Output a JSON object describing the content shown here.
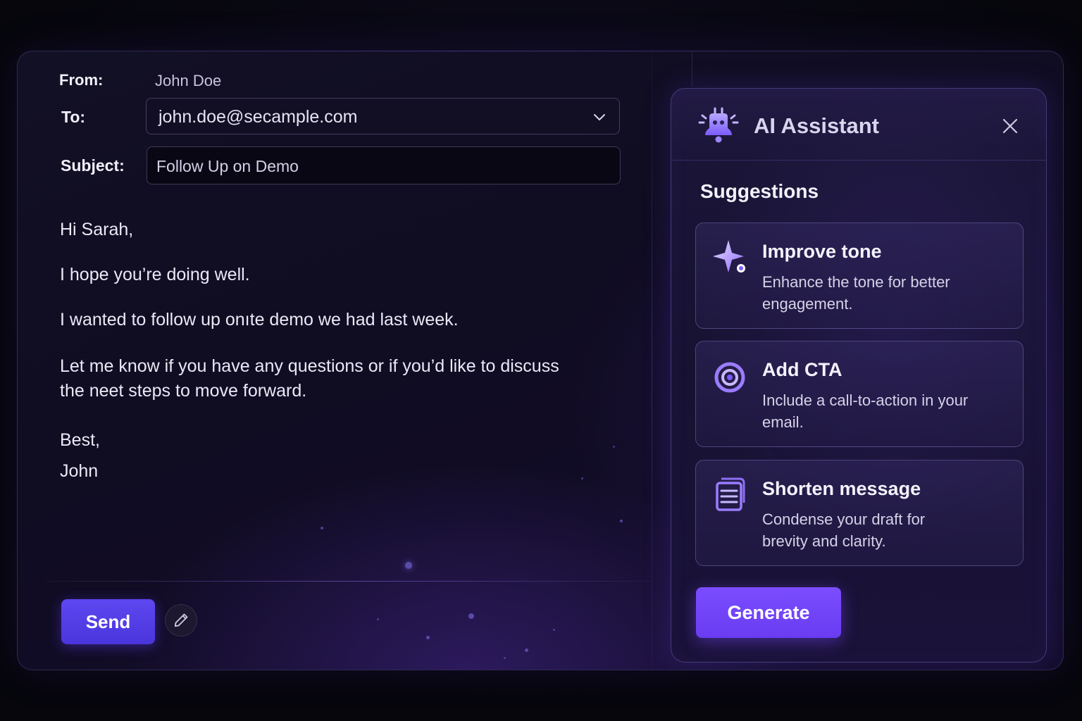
{
  "compose": {
    "from_label": "From:",
    "from_value": "John Doe",
    "to_label": "To:",
    "to_value": "john.doe@secample.com",
    "subject_label": "Subject:",
    "subject_value": "Follow Up on Demo",
    "body": {
      "greeting": "Hi Sarah,",
      "line1": "I hope you’re doing well.",
      "line2": "I wanted to follow up onıte demo we had last week.",
      "line3": "Let me know if you have any questions or if you’d like to discuss the neet steps to move forward.",
      "signoff": "Best,",
      "signature": "John"
    },
    "send_label": "Send",
    "edit_icon": "pencil-icon"
  },
  "assistant": {
    "title": "AI Assistant",
    "icon": "robot-icon",
    "close_icon": "close-icon",
    "suggestions_title": "Suggestions",
    "suggestions": [
      {
        "icon": "sparkle-icon",
        "title": "Improve tone",
        "description": "Enhance the tone for better engagement."
      },
      {
        "icon": "target-icon",
        "title": "Add CTA",
        "description": "Include a call-to-action in your email."
      },
      {
        "icon": "document-icon",
        "title": "Shorten message",
        "description": "Condense your draft for brevity and clarity."
      }
    ],
    "generate_label": "Generate"
  },
  "colors": {
    "accent": "#5d47f0",
    "generate": "#7b4dff",
    "background": "#06060c"
  }
}
